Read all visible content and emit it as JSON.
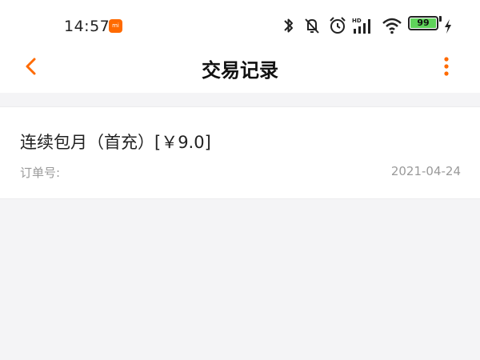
{
  "status_bar": {
    "time": "14:57",
    "app_badge": "mi",
    "battery_level": "99",
    "icons": [
      "bluetooth-icon",
      "mute-icon",
      "alarm-icon",
      "hd-signal-icon",
      "wifi-icon",
      "battery-icon",
      "charging-icon"
    ]
  },
  "nav": {
    "title": "交易记录",
    "back_icon": "chevron-left-icon",
    "more_icon": "more-vertical-icon"
  },
  "record": {
    "title": "连续包月（首充）[￥9.0]",
    "order_label": "订单号:",
    "date": "2021-04-24"
  },
  "colors": {
    "accent": "#ff6a00",
    "background": "#f4f4f6",
    "text_primary": "#222222",
    "text_secondary": "#9a9a9a"
  }
}
